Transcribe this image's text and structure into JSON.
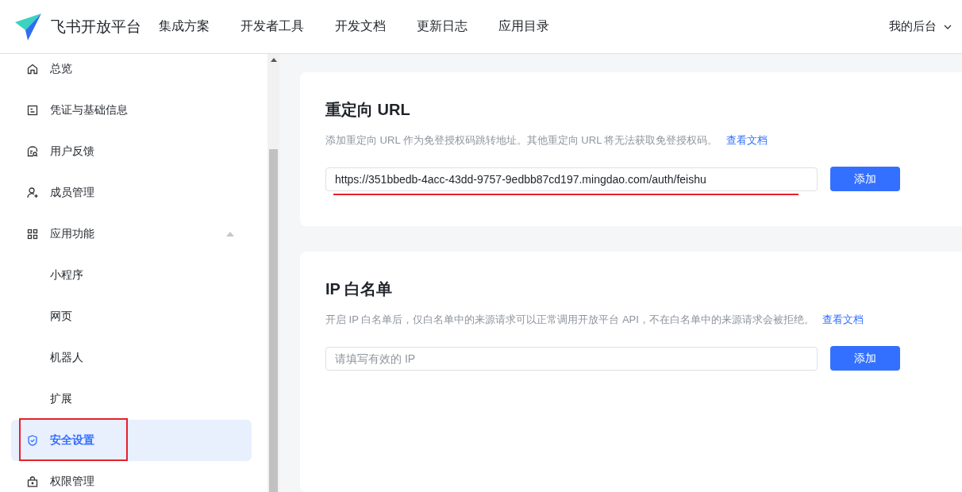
{
  "header": {
    "brand": "飞书开放平台",
    "nav": [
      {
        "label": "集成方案"
      },
      {
        "label": "开发者工具"
      },
      {
        "label": "开发文档"
      },
      {
        "label": "更新日志"
      },
      {
        "label": "应用目录"
      }
    ],
    "account": "我的后台"
  },
  "sidebar": {
    "items": [
      {
        "label": "总览",
        "selected": false
      },
      {
        "label": "凭证与基础信息",
        "selected": false
      },
      {
        "label": "用户反馈",
        "selected": false
      },
      {
        "label": "成员管理",
        "selected": false
      },
      {
        "label": "应用功能",
        "selected": false,
        "expanded": true,
        "children": [
          {
            "label": "小程序",
            "selected": false
          },
          {
            "label": "网页",
            "selected": false
          },
          {
            "label": "机器人",
            "selected": false
          },
          {
            "label": "扩展",
            "selected": false
          }
        ]
      },
      {
        "label": "安全设置",
        "selected": true,
        "annotated": true
      },
      {
        "label": "权限管理",
        "selected": false
      }
    ]
  },
  "sections": [
    {
      "title": "重定向 URL",
      "description": "添加重定向 URL 作为免登授权码跳转地址。其他重定向 URL 将无法获取免登授权码。",
      "link": "查看文档",
      "field": {
        "value": "https://351bbedb-4acc-43dd-9757-9edbb87cd197.mingdao.com/auth/feishu",
        "annotated": true
      },
      "button": "添加"
    },
    {
      "title": "IP 白名单",
      "description": "开启 IP 白名单后，仅白名单中的来源请求可以正常调用开放平台 API，不在白名单中的来源请求会被拒绝。",
      "link": "查看文档",
      "field": {
        "placeholder": "请填写有效的 IP"
      },
      "button": "添加"
    }
  ]
}
